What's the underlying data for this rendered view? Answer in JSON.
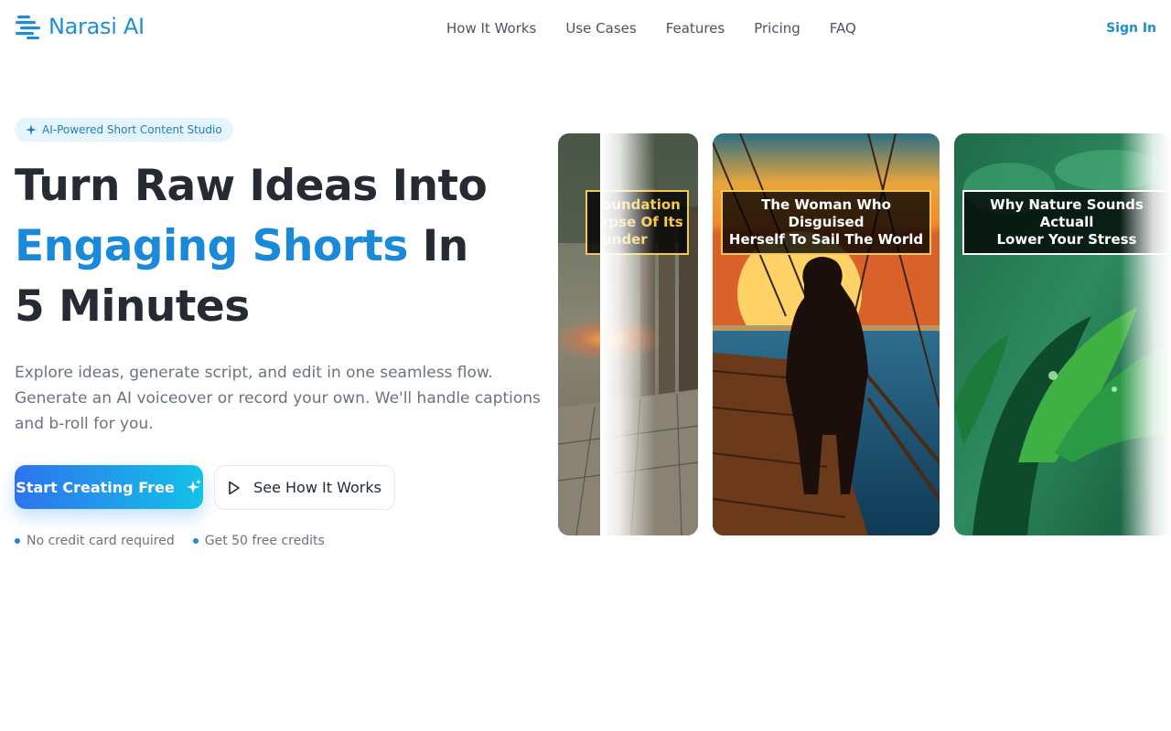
{
  "brand": {
    "name": "Narasi AI",
    "accent": "#1a8ad8"
  },
  "nav": {
    "items": [
      {
        "label": "How It Works"
      },
      {
        "label": "Use Cases"
      },
      {
        "label": "Features"
      },
      {
        "label": "Pricing"
      },
      {
        "label": "FAQ"
      }
    ],
    "signin": "Sign In"
  },
  "hero": {
    "badge": "AI-Powered Short Content Studio",
    "headline_line1": "Turn Raw Ideas Into",
    "headline_accent": "Engaging Shorts",
    "headline_after_accent": "In",
    "headline_line3": "5 Minutes",
    "description_line1": "Explore ideas, generate script, and edit in one seamless flow.",
    "description_line2": "Generate an AI voiceover or record your own. We'll handle captions",
    "description_line3": "and b-roll for you.",
    "cta_primary": "Start Creating Free",
    "cta_secondary": "See How It Works",
    "perks": [
      {
        "label": "No credit card required"
      },
      {
        "label": "Get 50 free credits"
      }
    ]
  },
  "cards": [
    {
      "caption_line1": "oundation",
      "caption_line2": "rpse Of Its",
      "caption_line3": "under"
    },
    {
      "caption_line1": "The Woman Who Disguised",
      "caption_line2": "Herself To Sail The World"
    },
    {
      "caption_line1": "Why Nature Sounds Actuall",
      "caption_line2": "Lower Your Stress"
    }
  ],
  "colors": {
    "cta_gradient_start": "#2e73ee",
    "cta_gradient_end": "#13c2e8",
    "caption_border": "#f2c94c"
  }
}
